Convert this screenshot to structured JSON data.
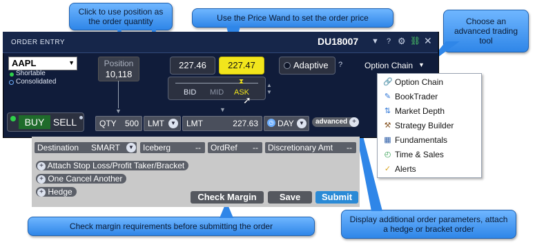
{
  "callouts": {
    "position_qty": "Click to use position as the order quantity",
    "price_wand": "Use the Price Wand to set the order price",
    "advanced_tool": "Choose an advanced trading tool",
    "check_margin": "Check margin requirements before submitting the order",
    "advanced_params": "Display additional order parameters, attach a hedge or bracket order"
  },
  "window": {
    "title": "ORDER ENTRY",
    "account": "DU18007",
    "help": "?"
  },
  "symbol": {
    "value": "AAPL",
    "shortable": "Shortable",
    "consolidated": "Consolidated"
  },
  "position": {
    "label": "Position",
    "value": "10,118"
  },
  "quotes": {
    "bid": "227.46",
    "ask": "227.47"
  },
  "wand": {
    "bid_label": "BID",
    "mid_label": "MID",
    "ask_label": "ASK"
  },
  "adaptive": {
    "label": "Adaptive",
    "help": "?"
  },
  "option_chain": {
    "label": "Option Chain"
  },
  "buy_sell": {
    "buy": "BUY",
    "sell": "SELL"
  },
  "order": {
    "qty_label": "QTY",
    "qty_value": "500",
    "type": "LMT",
    "price_label": "LMT",
    "price_value": "227.63",
    "tif": "DAY",
    "advanced": "advanced"
  },
  "lower": {
    "destination_label": "Destination",
    "destination_value": "SMART",
    "iceberg_label": "Iceberg",
    "iceberg_value": "--",
    "ordref_label": "OrdRef",
    "ordref_value": "--",
    "discretionary_label": "Discretionary Amt",
    "discretionary_value": "--",
    "attach_bracket": "Attach Stop Loss/Profit Taker/Bracket",
    "oca": "One Cancel Another",
    "hedge": "Hedge"
  },
  "buttons": {
    "check_margin": "Check Margin",
    "save": "Save",
    "submit": "Submit"
  },
  "menu": {
    "items": [
      {
        "label": "Option Chain",
        "icon": "option-chain-icon"
      },
      {
        "label": "BookTrader",
        "icon": "booktrader-icon"
      },
      {
        "label": "Market Depth",
        "icon": "market-depth-icon"
      },
      {
        "label": "Strategy Builder",
        "icon": "strategy-builder-icon"
      },
      {
        "label": "Fundamentals",
        "icon": "fundamentals-icon"
      },
      {
        "label": "Time & Sales",
        "icon": "time-sales-icon"
      },
      {
        "label": "Alerts",
        "icon": "alerts-icon"
      }
    ]
  },
  "colors": {
    "panel": "#101c3a",
    "ask_highlight": "#f2e51c",
    "submit": "#2a8ad6",
    "callout": "#4a9cf0"
  }
}
